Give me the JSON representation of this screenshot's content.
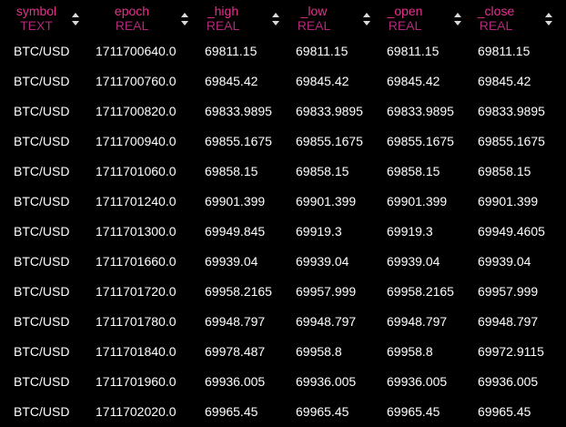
{
  "columns": [
    {
      "name": "symbol",
      "type": "TEXT"
    },
    {
      "name": "epoch",
      "type": "REAL"
    },
    {
      "name": "_high",
      "type": "REAL"
    },
    {
      "name": "_low",
      "type": "REAL"
    },
    {
      "name": "_open",
      "type": "REAL"
    },
    {
      "name": "_close",
      "type": "REAL"
    }
  ],
  "rows": [
    [
      "BTC/USD",
      "1711700640.0",
      "69811.15",
      "69811.15",
      "69811.15",
      "69811.15"
    ],
    [
      "BTC/USD",
      "1711700760.0",
      "69845.42",
      "69845.42",
      "69845.42",
      "69845.42"
    ],
    [
      "BTC/USD",
      "1711700820.0",
      "69833.9895",
      "69833.9895",
      "69833.9895",
      "69833.9895"
    ],
    [
      "BTC/USD",
      "1711700940.0",
      "69855.1675",
      "69855.1675",
      "69855.1675",
      "69855.1675"
    ],
    [
      "BTC/USD",
      "1711701060.0",
      "69858.15",
      "69858.15",
      "69858.15",
      "69858.15"
    ],
    [
      "BTC/USD",
      "1711701240.0",
      "69901.399",
      "69901.399",
      "69901.399",
      "69901.399"
    ],
    [
      "BTC/USD",
      "1711701300.0",
      "69949.845",
      "69919.3",
      "69919.3",
      "69949.4605"
    ],
    [
      "BTC/USD",
      "1711701660.0",
      "69939.04",
      "69939.04",
      "69939.04",
      "69939.04"
    ],
    [
      "BTC/USD",
      "1711701720.0",
      "69958.2165",
      "69957.999",
      "69958.2165",
      "69957.999"
    ],
    [
      "BTC/USD",
      "1711701780.0",
      "69948.797",
      "69948.797",
      "69948.797",
      "69948.797"
    ],
    [
      "BTC/USD",
      "1711701840.0",
      "69978.487",
      "69958.8",
      "69958.8",
      "69972.9115"
    ],
    [
      "BTC/USD",
      "1711701960.0",
      "69936.005",
      "69936.005",
      "69936.005",
      "69936.005"
    ],
    [
      "BTC/USD",
      "1711702020.0",
      "69965.45",
      "69965.45",
      "69965.45",
      "69965.45"
    ]
  ],
  "icons": {
    "sort": "sort-updown-icon"
  },
  "colors": {
    "background": "#000000",
    "header_name": "#e8308f",
    "header_type": "#b0287a",
    "cell_text": "#ffffff",
    "sort_icon": "#d8d8d8"
  }
}
